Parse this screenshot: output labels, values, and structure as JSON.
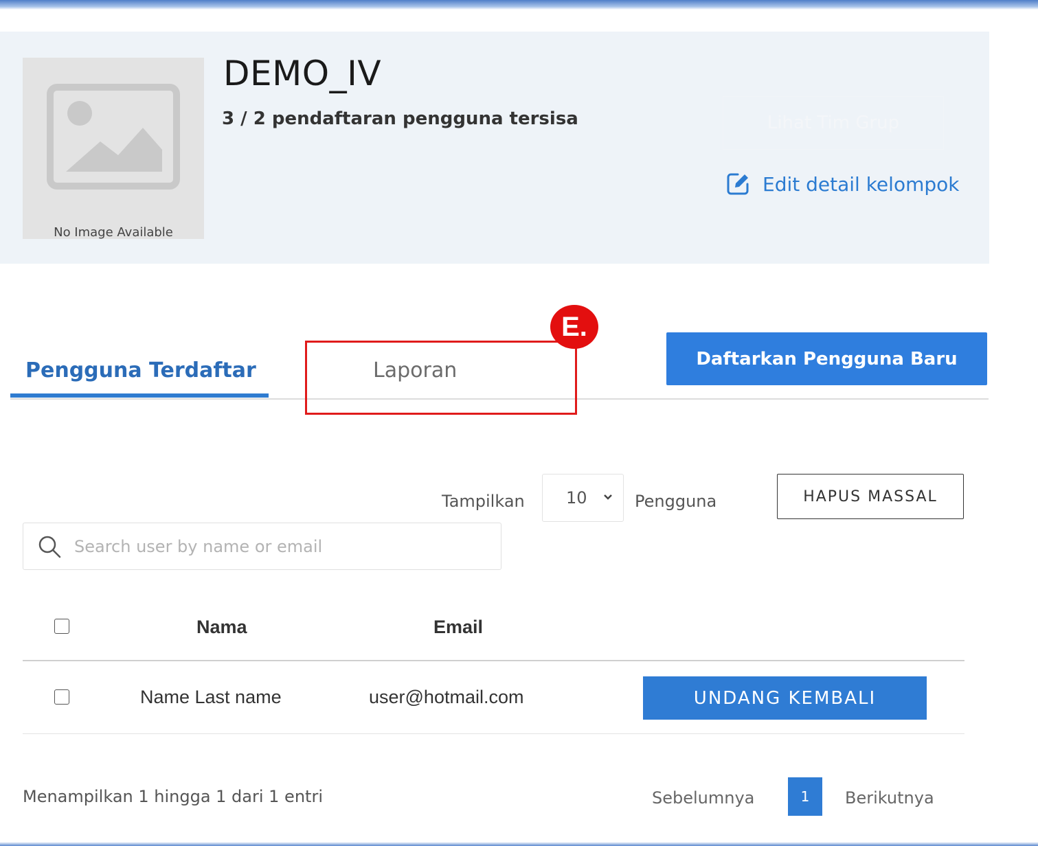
{
  "group": {
    "name": "DEMO_IV",
    "quota_text": "3 / 2 pendaftaran pengguna tersisa",
    "image_caption": "No Image Available",
    "ghost_button_label": "Lihat Tim Grup",
    "edit_link_label": "Edit detail kelompok"
  },
  "tabs": [
    {
      "label": "Pengguna Terdaftar",
      "active": true
    },
    {
      "label": "Laporan",
      "active": false
    }
  ],
  "annotation": {
    "step_label": "E.",
    "color": "#e01b1b"
  },
  "register_button_label": "Daftarkan Pengguna Baru",
  "list_controls": {
    "show_label": "Tampilkan",
    "page_size": "10",
    "users_label": "Pengguna",
    "bulk_delete_label": "HAPUS MASSAL",
    "search_placeholder": "Search user by name or email"
  },
  "table": {
    "columns": [
      "Nama",
      "Email"
    ],
    "rows": [
      {
        "name": "Name Last name",
        "email": "user@hotmail.com",
        "action": "UNDANG KEMBALI"
      }
    ]
  },
  "pagination": {
    "info": "Menampilkan 1 hingga 1 dari 1 entri",
    "prev": "Sebelumnya",
    "current_page": "1",
    "next": "Berikutnya"
  },
  "colors": {
    "accent": "#2f7cd4",
    "panel": "#eef3f8"
  },
  "icons": [
    "image-placeholder-icon",
    "edit-icon",
    "chevron-down-icon",
    "search-icon"
  ]
}
